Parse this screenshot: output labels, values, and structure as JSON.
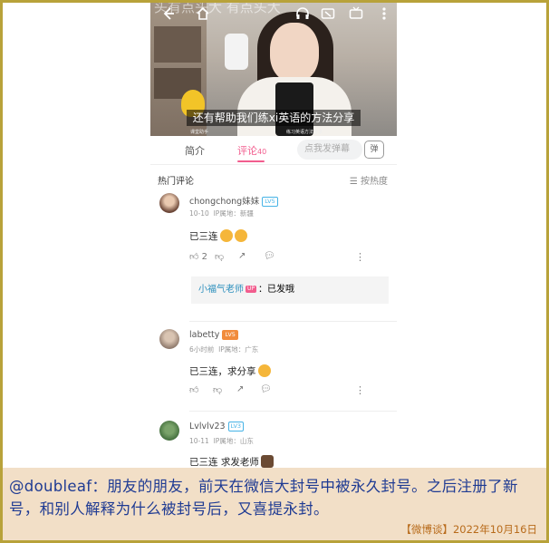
{
  "video": {
    "watermark": "头有点头大  有点头大",
    "subtitle": "还有帮助我们练xi英语的方法分享",
    "caption_left": "课堂助手",
    "caption_right": "练习英语方法分享"
  },
  "topbar": {
    "icons": [
      "back-icon",
      "home-icon",
      "headphone-icon",
      "cast-icon",
      "tv-icon",
      "more-vert-icon"
    ]
  },
  "tabs": {
    "intro": "简介",
    "comments": "评论",
    "comments_count": "40",
    "danmu_placeholder": "点我发弹幕",
    "danmu_button": "弹"
  },
  "comments_header": {
    "title": "热门评论",
    "sort": "按热度"
  },
  "comments": [
    {
      "username": "chongchong妹妹",
      "level": "LV5",
      "level_color": "#46b3e6",
      "date": "10-10",
      "ip": "IP属地：新疆",
      "text": "已三连",
      "likes": "2",
      "reply": {
        "name": "小福气老师",
        "badge": "UP",
        "text": "：已发哦"
      }
    },
    {
      "username": "labetty",
      "level": "LV5",
      "level_color": "#f18c3c",
      "date": "6小时前",
      "ip": "IP属地：广东",
      "text": "已三连，求分享"
    },
    {
      "username": "Lvlvlv23",
      "level": "LV3",
      "level_color": "#46b3e6",
      "date": "10-11",
      "ip": "IP属地：山东",
      "text": "已三连 求发老师"
    }
  ],
  "caption": {
    "text": "@doubleaf：朋友的朋友，前天在微信大封号中被永久封号。之后注册了新号，和别人解释为什么被封号后，又喜提永封。",
    "source": "【微博谈】2022年10月16日"
  },
  "colors": {
    "accent": "#f25d8e",
    "caption_bg": "#f2dfc7",
    "caption_text": "#1f3b93",
    "source_text": "#b86b1b",
    "border": "#b8a23a"
  }
}
